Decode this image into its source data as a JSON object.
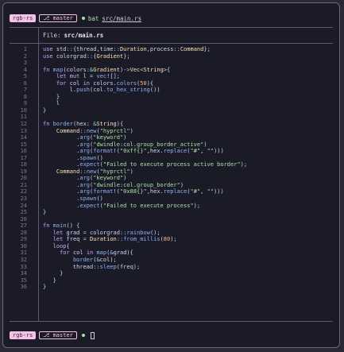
{
  "prompt_top": {
    "dir": "rgb-rs",
    "branch": "⎇ master",
    "command": "bat",
    "argument": "src/main.rs"
  },
  "file_header": {
    "label": "File:",
    "name": "src/main.rs"
  },
  "code_lines": [
    {
      "n": "1",
      "t": "use std::{thread,time::Duration,process::Command};"
    },
    {
      "n": "2",
      "t": "use colorgrad::{Gradient};"
    },
    {
      "n": "3",
      "t": ""
    },
    {
      "n": "4",
      "t": "fn map(colors:&Gradient)->Vec<String>{"
    },
    {
      "n": "5",
      "t": "    let mut l = vec![];"
    },
    {
      "n": "6",
      "t": "    for col in colors.colors(50){"
    },
    {
      "n": "7",
      "t": "        l.push(col.to_hex_string())"
    },
    {
      "n": "8",
      "t": "    }"
    },
    {
      "n": "9",
      "t": "    l"
    },
    {
      "n": "10",
      "t": "}"
    },
    {
      "n": "11",
      "t": ""
    },
    {
      "n": "12",
      "t": "fn border(hex: &String){"
    },
    {
      "n": "13",
      "t": "    Command::new(\"hyprctl\")"
    },
    {
      "n": "14",
      "t": "          .arg(\"keyword\")"
    },
    {
      "n": "15",
      "t": "          .arg(\"dwindle:col.group_border_active\")"
    },
    {
      "n": "16",
      "t": "          .arg(format!(\"0xff{}\",hex.replace(\"#\", \"\")))"
    },
    {
      "n": "17",
      "t": "          .spawn()"
    },
    {
      "n": "18",
      "t": "          .expect(\"Failed to execute process active border\");"
    },
    {
      "n": "19",
      "t": "    Command::new(\"hyprctl\")"
    },
    {
      "n": "20",
      "t": "          .arg(\"keyword\")"
    },
    {
      "n": "21",
      "t": "          .arg(\"dwindle:col.group_border\")"
    },
    {
      "n": "22",
      "t": "          .arg(format!(\"0x88{}\",hex.replace(\"#\", \"\")))"
    },
    {
      "n": "23",
      "t": "          .spawn()"
    },
    {
      "n": "24",
      "t": "          .expect(\"Failed to execute process\");"
    },
    {
      "n": "25",
      "t": "}"
    },
    {
      "n": "26",
      "t": ""
    },
    {
      "n": "27",
      "t": "fn main() {"
    },
    {
      "n": "28",
      "t": "   let grad = colorgrad::rainbow();"
    },
    {
      "n": "29",
      "t": "   let freq = Duration::from_millis(80);"
    },
    {
      "n": "30",
      "t": "   loop{"
    },
    {
      "n": "31",
      "t": "     for col in map(&grad){"
    },
    {
      "n": "32",
      "t": "         border(&col);"
    },
    {
      "n": "33",
      "t": "         thread::sleep(freq);"
    },
    {
      "n": "34",
      "t": "     }"
    },
    {
      "n": "35",
      "t": "   }"
    },
    {
      "n": "36",
      "t": "}"
    }
  ],
  "prompt_bottom": {
    "dir": "rgb-rs",
    "branch": "⎇ master"
  },
  "colors": {
    "accent": "#f5c2e7",
    "background": "#1b1a27",
    "ok": "#a6e3a1"
  }
}
